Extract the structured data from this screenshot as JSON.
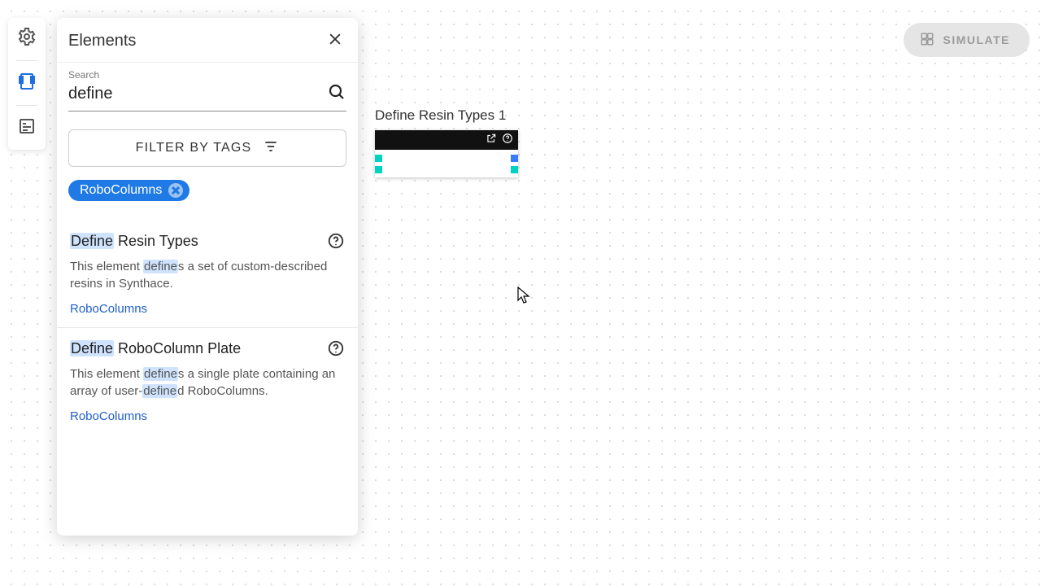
{
  "simulate_label": "SIMULATE",
  "rail": {
    "active_index": 1
  },
  "panel": {
    "title": "Elements",
    "search_label": "Search",
    "search_value": "define",
    "filter_label": "FILTER BY TAGS",
    "active_tags": [
      "RoboColumns"
    ],
    "results": [
      {
        "title_pre": "Define",
        "title_rest": " Resin Types",
        "desc_pre": "This element ",
        "desc_hl1": "define",
        "desc_mid1": "s a set of custom-described resins in Synthace.",
        "desc_hl2": "",
        "desc_mid2": "",
        "tag": "RoboColumns"
      },
      {
        "title_pre": "Define",
        "title_rest": " RoboColumn Plate",
        "desc_pre": "This element ",
        "desc_hl1": "define",
        "desc_mid1": "s a single plate containing an array of user-",
        "desc_hl2": "define",
        "desc_mid2": "d RoboColumns.",
        "tag": "RoboColumns"
      }
    ]
  },
  "canvas": {
    "node_title": "Define Resin Types 1"
  }
}
